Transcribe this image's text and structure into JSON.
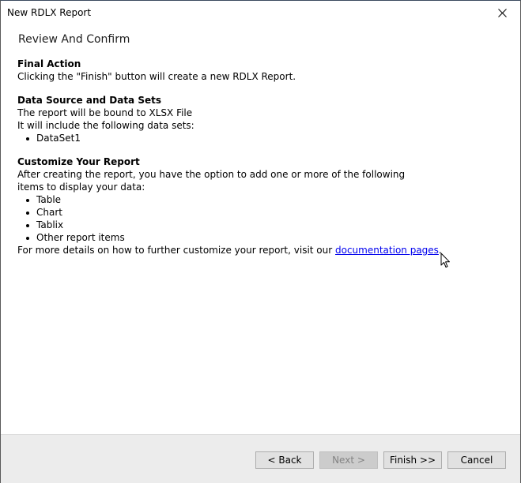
{
  "window": {
    "title": "New RDLX Report",
    "close_icon": "close-icon"
  },
  "page": {
    "title": "Review And Confirm"
  },
  "sections": {
    "final_action": {
      "title": "Final Action",
      "text": "Clicking the \"Finish\" button will create a new RDLX Report."
    },
    "data_source": {
      "title": "Data Source and Data Sets",
      "line1": "The report will be bound to XLSX File",
      "line2": "It will include the following data sets:",
      "datasets": [
        "DataSet1"
      ]
    },
    "customize": {
      "title": "Customize Your Report",
      "text": "After creating the report, you have the option to add one or more of the following items to display your data:",
      "items": [
        "Table",
        "Chart",
        "Tablix",
        "Other report items"
      ],
      "more_prefix": "For more details on how to further customize your report, visit our ",
      "link_text": "documentation pages",
      "more_suffix": "."
    }
  },
  "footer": {
    "back_label": "< Back",
    "next_label": "Next >",
    "next_enabled": false,
    "finish_label": "Finish >>",
    "cancel_label": "Cancel"
  }
}
